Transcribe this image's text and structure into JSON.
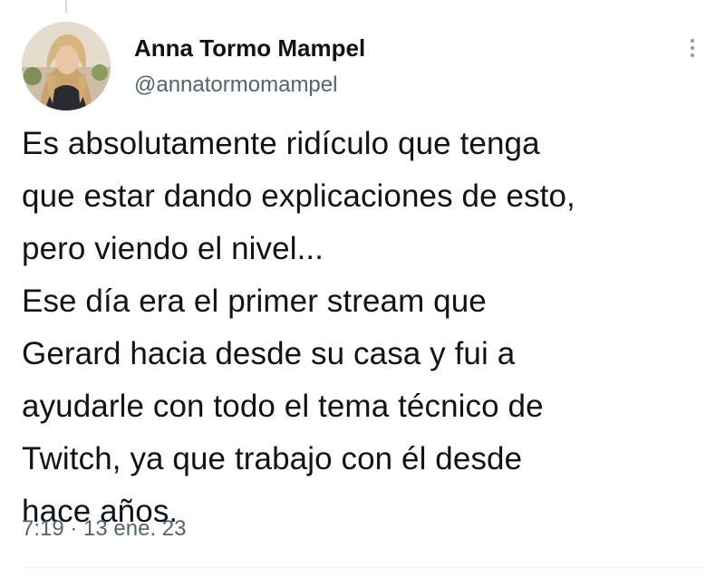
{
  "tweet": {
    "author_name": "Anna Tormo Mampel",
    "handle": "@annatormomampel",
    "text_lines": [
      "Es absolutamente ridículo que tenga",
      "que estar dando explicaciones de esto,",
      "pero viendo el nivel...",
      "Ese día era el primer stream que",
      "Gerard hacia desde su casa y fui a",
      "ayudarle con todo el tema técnico de",
      "Twitch, ya que trabajo con él desde",
      "hace años."
    ],
    "timestamp": "7:19 · 13 ene. 23"
  },
  "icons": {
    "more": "more-vertical-icon",
    "avatar": "profile-photo"
  },
  "colors": {
    "text": "#0f1419",
    "secondary_text": "#536471",
    "divider": "#eff3f4"
  }
}
